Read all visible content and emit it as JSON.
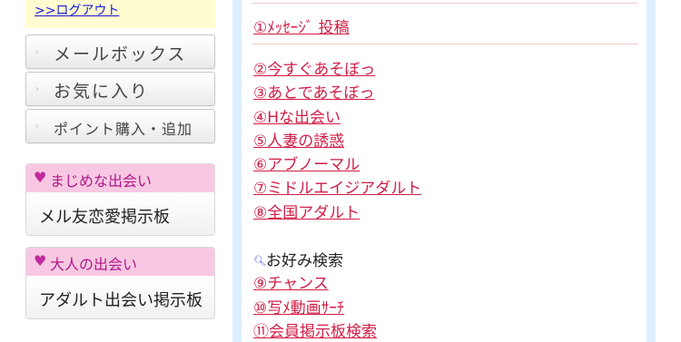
{
  "sidebar": {
    "logout_label": ">>ログアウト",
    "menu": [
      {
        "label": "メールボックス"
      },
      {
        "label": "お気に入り"
      },
      {
        "label": "ポイント購入・追加"
      }
    ],
    "categories": [
      {
        "heading": "まじめな出会い",
        "link": "メル友恋愛掲示板"
      },
      {
        "heading": "大人の出会い",
        "link": "アダルト出会い掲示板"
      }
    ]
  },
  "main": {
    "post_link": "①ﾒｯｾｰｼﾞ 投稿",
    "boards": [
      "②今すぐあそぼっ",
      "③あとであそぼっ",
      "④Hな出会い",
      "⑤人妻の誘惑",
      "⑥アブノーマル",
      "⑦ミドルエイジアダルト",
      "⑧全国アダルト"
    ],
    "search_label": "お好み検索",
    "search_links": [
      "⑨チャンス",
      "⑩写ﾒ動画ｻｰﾁ",
      "⑪会員掲示板検索"
    ]
  },
  "colors": {
    "link": "#d21e46",
    "category_header": "#f8c8e2",
    "logout_bg": "#fffcd1",
    "band": "#ddeeff"
  }
}
